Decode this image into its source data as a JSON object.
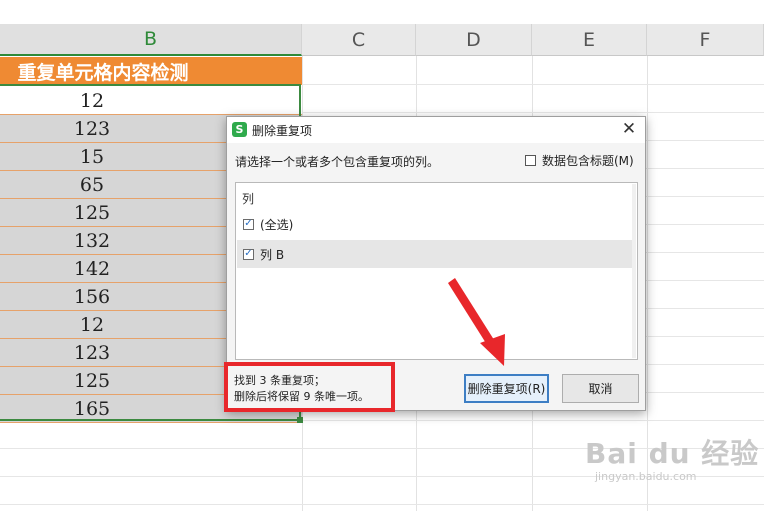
{
  "columns": [
    "B",
    "C",
    "D",
    "E",
    "F"
  ],
  "table_header": "重复单元格内容检测",
  "cells": [
    "12",
    "123",
    "15",
    "65",
    "125",
    "132",
    "142",
    "156",
    "12",
    "123",
    "125",
    "165"
  ],
  "dialog": {
    "app_icon": "S",
    "title": "删除重复项",
    "close": "✕",
    "instruction": "请选择一个或者多个包含重复项的列。",
    "header_checkbox_label": "数据包含标题(M)",
    "list_header": "列",
    "items": [
      {
        "label": "(全选)",
        "checked": true
      },
      {
        "label": "列 B",
        "checked": true
      }
    ],
    "status_line1": "找到 3 条重复项；",
    "status_line2": "删除后将保留 9 条唯一项。",
    "primary_button": "删除重复项(R)",
    "cancel_button": "取消"
  },
  "watermark": {
    "logo": "Bai du 经验",
    "url": "jingyan.baidu.com"
  },
  "colors": {
    "header_orange": "#ef8a33",
    "selection_green": "#3c8a40",
    "highlight_red": "#e8272b",
    "arrow_red": "#e8272b"
  }
}
